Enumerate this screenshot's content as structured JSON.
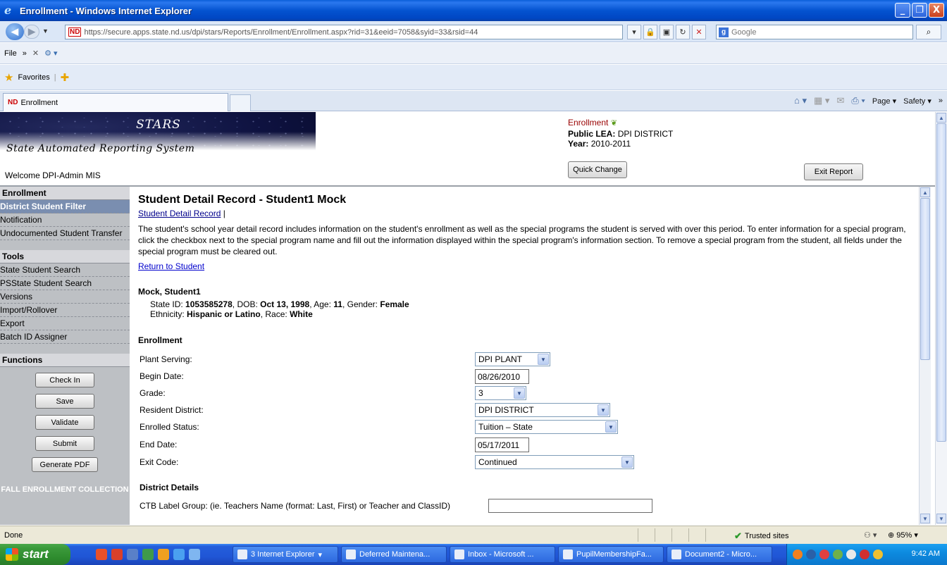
{
  "window": {
    "title": "Enrollment - Windows Internet Explorer",
    "minimize": "_",
    "maximize": "❐",
    "close": "X"
  },
  "browser": {
    "url": "https://secure.apps.state.nd.us/dpi/stars/Reports/Enrollment/Enrollment.aspx?rid=31&eeid=7058&syid=33&rsid=44",
    "favicon_text": "ND",
    "search_placeholder": "Google",
    "menu_file": "File",
    "menu_more": "»",
    "favorites_label": "Favorites",
    "tab_title": "Enrollment",
    "cmd_page": "Page ▾",
    "cmd_safety": "Safety ▾",
    "cmd_more": "»"
  },
  "header": {
    "app_name": "STARS",
    "app_subtitle": "State Automated Reporting System",
    "welcome": "Welcome DPI-Admin MIS",
    "report_name": "Enrollment",
    "lea_label": "Public LEA:",
    "lea_value": "DPI DISTRICT",
    "year_label": "Year:",
    "year_value": "2010-2011",
    "quick_change": "Quick Change",
    "exit_report": "Exit Report"
  },
  "sidebar": {
    "section_enrollment": "Enrollment",
    "enrollment_items": [
      "District Student Filter",
      "Notification",
      "Undocumented Student Transfer"
    ],
    "section_tools": "Tools",
    "tools_items": [
      "State Student Search",
      "PSState Student Search",
      "Versions",
      "Import/Rollover",
      "Export",
      "Batch ID Assigner"
    ],
    "section_functions": "Functions",
    "function_buttons": [
      "Check In",
      "Save",
      "Validate",
      "Submit",
      "Generate PDF"
    ],
    "footer": "FALL ENROLLMENT COLLECTION"
  },
  "main": {
    "title": "Student Detail Record - Student1 Mock",
    "subnav_link": "Student Detail Record",
    "subnav_sep": "|",
    "intro": "The student's school year detail record includes information on the student's enrollment as well as the special programs the student is served with over this period. To enter information for a special program, click the checkbox next to the special program name and fill out the information displayed within the special program's information section. To remove a special program from the student, all fields under the special program must be cleared out.",
    "return_link": "Return to Student",
    "student": {
      "name": "Mock, Student1",
      "state_id_label": "State ID:",
      "state_id": "1053585278",
      "dob_label": "DOB:",
      "dob": "Oct 13, 1998",
      "age_label": "Age:",
      "age": "11",
      "gender_label": "Gender:",
      "gender": "Female",
      "ethnicity_label": "Ethnicity:",
      "ethnicity": "Hispanic or Latino",
      "race_label": "Race:",
      "race": "White"
    },
    "enrollment_heading": "Enrollment",
    "fields": {
      "plant_serving": {
        "label": "Plant Serving:",
        "value": "DPI PLANT"
      },
      "begin_date": {
        "label": "Begin Date:",
        "value": "08/26/2010"
      },
      "grade": {
        "label": "Grade:",
        "value": "3"
      },
      "resident_district": {
        "label": "Resident District:",
        "value": "DPI DISTRICT"
      },
      "enrolled_status": {
        "label": "Enrolled Status:",
        "value": "Tuition – State"
      },
      "end_date": {
        "label": "End Date:",
        "value": "05/17/2011"
      },
      "exit_code": {
        "label": "Exit Code:",
        "value": "Continued"
      }
    },
    "district_details_heading": "District Details",
    "ctb_label": "CTB Label Group: (ie. Teachers Name (format: Last, First) or Teacher and ClassID)",
    "ctb_value": ""
  },
  "statusbar": {
    "status": "Done",
    "zone": "Trusted sites",
    "zoom": "95%"
  },
  "taskbar": {
    "start": "start",
    "tasks": [
      "3 Internet Explorer",
      "Deferred Maintena...",
      "Inbox - Microsoft ...",
      "PupilMembershipFa...",
      "Document2 - Micro..."
    ],
    "clock": "9:42 AM"
  }
}
